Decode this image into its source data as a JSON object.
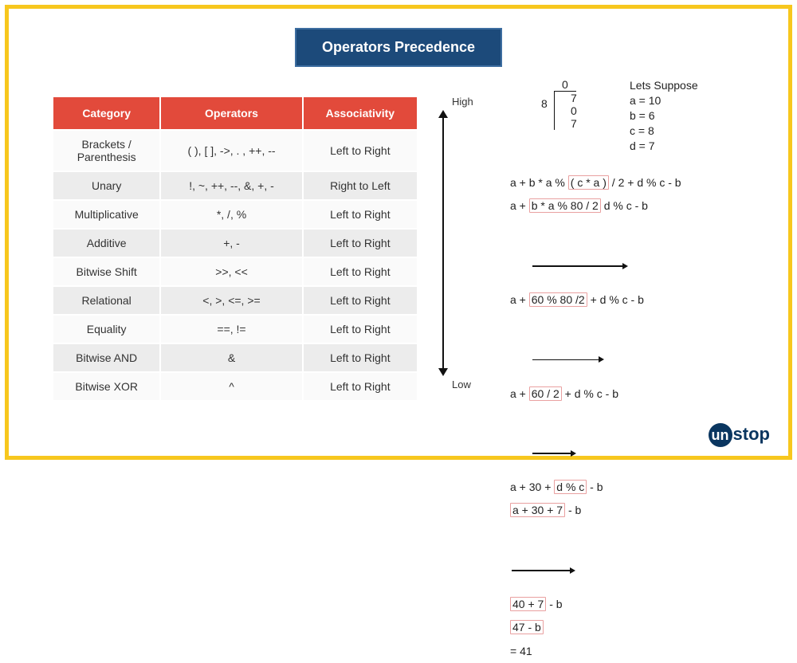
{
  "title": "Operators Precedence",
  "table": {
    "headers": [
      "Category",
      "Operators",
      "Associativity"
    ],
    "rows": [
      {
        "cat": "Brackets /\nParenthesis",
        "ops": "( ), [ ], ->, . , ++, --",
        "assoc": "Left to Right"
      },
      {
        "cat": "Unary",
        "ops": "!, ~, ++, --, &, +, -",
        "assoc": "Right to Left"
      },
      {
        "cat": "Multiplicative",
        "ops": "*, /, %",
        "assoc": "Left to Right"
      },
      {
        "cat": "Additive",
        "ops": "+, -",
        "assoc": "Left to Right"
      },
      {
        "cat": "Bitwise Shift",
        "ops": ">>, <<",
        "assoc": "Left to Right"
      },
      {
        "cat": "Relational",
        "ops": "<, >, <=, >=",
        "assoc": "Left to Right"
      },
      {
        "cat": "Equality",
        "ops": "==, !=",
        "assoc": "Left to Right"
      },
      {
        "cat": "Bitwise AND",
        "ops": "&",
        "assoc": "Left to Right"
      },
      {
        "cat": "Bitwise XOR",
        "ops": "^",
        "assoc": "Left to Right"
      }
    ]
  },
  "axis": {
    "high": "High",
    "low": "Low"
  },
  "longdiv": {
    "divisor": "8",
    "line0": "0",
    "line1": "7",
    "line2": "0",
    "line3": "7"
  },
  "suppose": {
    "title": "Lets Suppose",
    "lines": [
      "a = 10",
      "b = 6",
      "c = 8",
      "d = 7"
    ]
  },
  "steps": {
    "s1_pre": "a + b * a % ",
    "s1_hl": "( c * a )",
    "s1_post": " / 2 + d % c - b",
    "s2_pre": "a + ",
    "s2_hl": "b * a % 80 / 2",
    "s2_post": " d % c - b",
    "s3_pre": "a + ",
    "s3_hl": "60 % 80 /2",
    "s3_post": " + d % c - b",
    "s4_pre": "a + ",
    "s4_hl": "60 / 2",
    "s4_post": " + d % c - b",
    "s5_pre": "a + 30 + ",
    "s5_hl": "d % c",
    "s5_post": " - b",
    "s6_hl": "a + 30 + 7",
    "s6_post": " - b",
    "s7_hl": "40 + 7",
    "s7_post": " - b",
    "s8_hl": "47 - b",
    "s9": "= 41"
  },
  "logo": {
    "u": "un",
    "rest": "stop"
  }
}
